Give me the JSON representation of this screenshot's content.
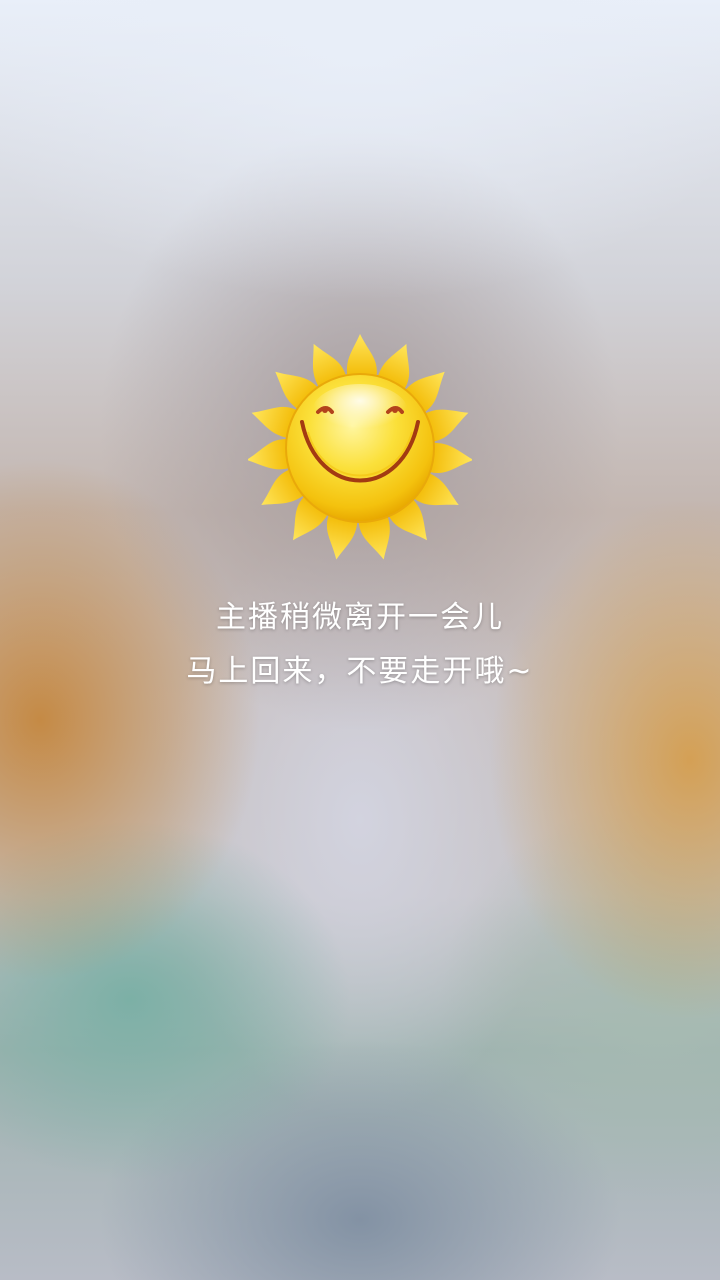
{
  "overlay": {
    "title_line": "主播稍微离开一会儿",
    "subtitle_line": "马上回来，不要走开哦~",
    "icon": "smiling-sun-icon"
  },
  "colors": {
    "text": "#ffffff",
    "sun_body": "#f7d21a",
    "sun_rays": "#f5c400"
  }
}
